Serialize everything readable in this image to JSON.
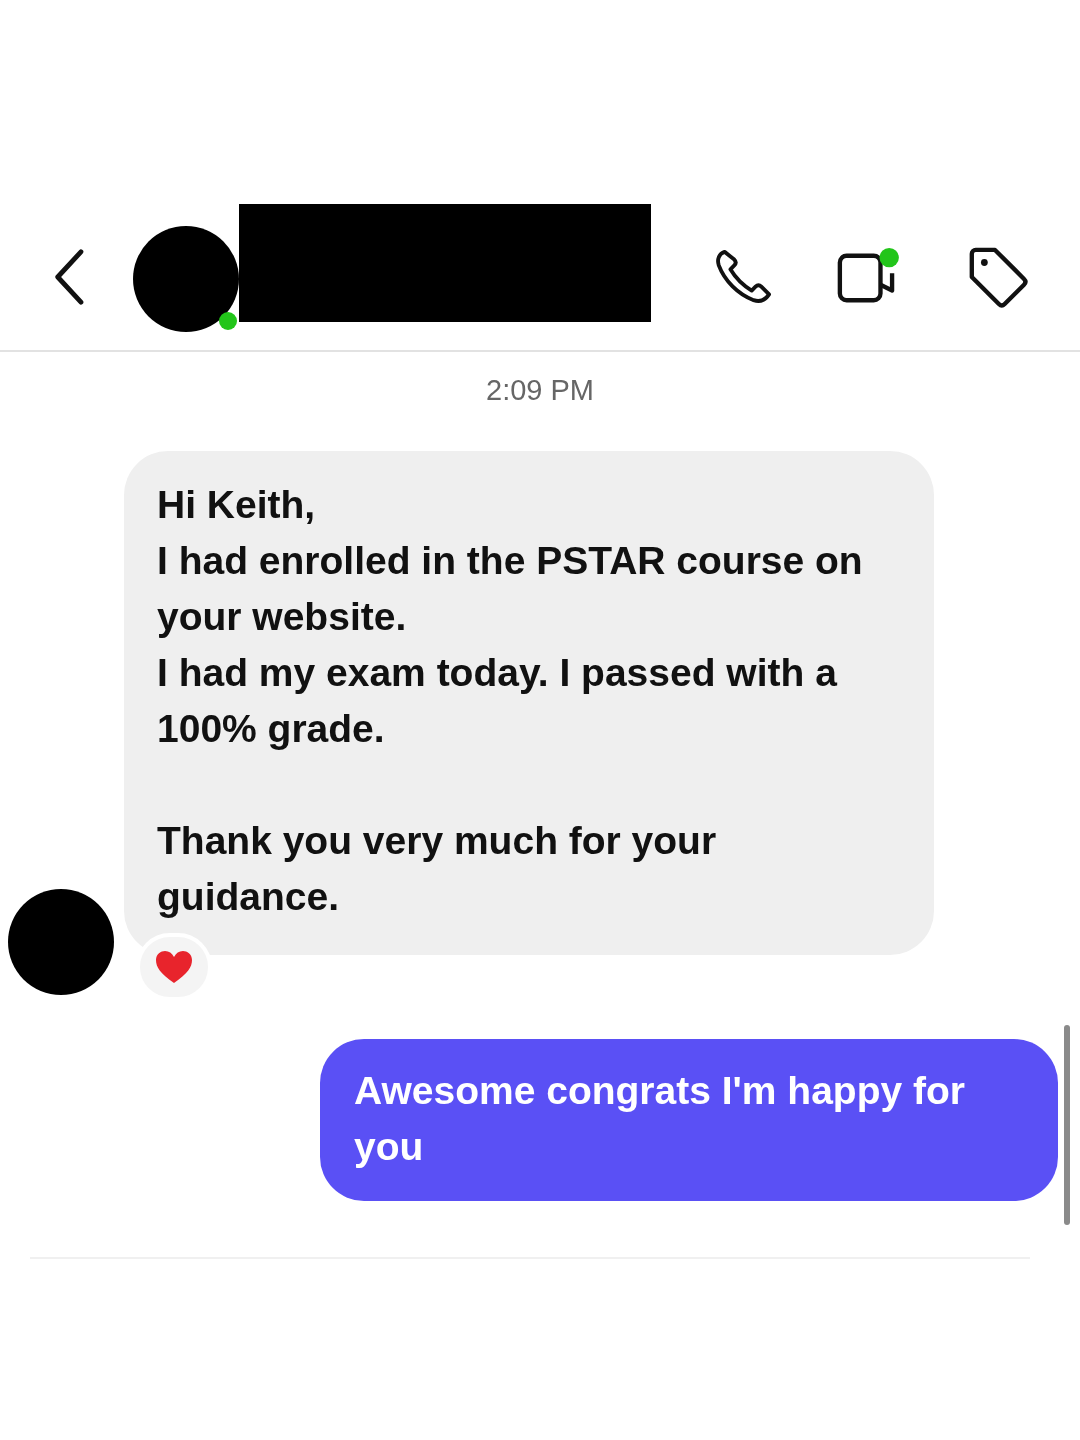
{
  "header": {
    "contact_online": true
  },
  "timestamp": "2:09 PM",
  "messages": [
    {
      "kind": "incoming",
      "reacted": true,
      "blocks": [
        [
          "Hi Keith,",
          "I had enrolled in the PSTAR course on your website.",
          "I had my exam today. I passed with a 100% grade."
        ],
        [
          "Thank you very much for your guidance."
        ]
      ]
    },
    {
      "kind": "outgoing",
      "blocks": [
        [
          "Awesome congrats I'm happy for you"
        ]
      ]
    }
  ]
}
